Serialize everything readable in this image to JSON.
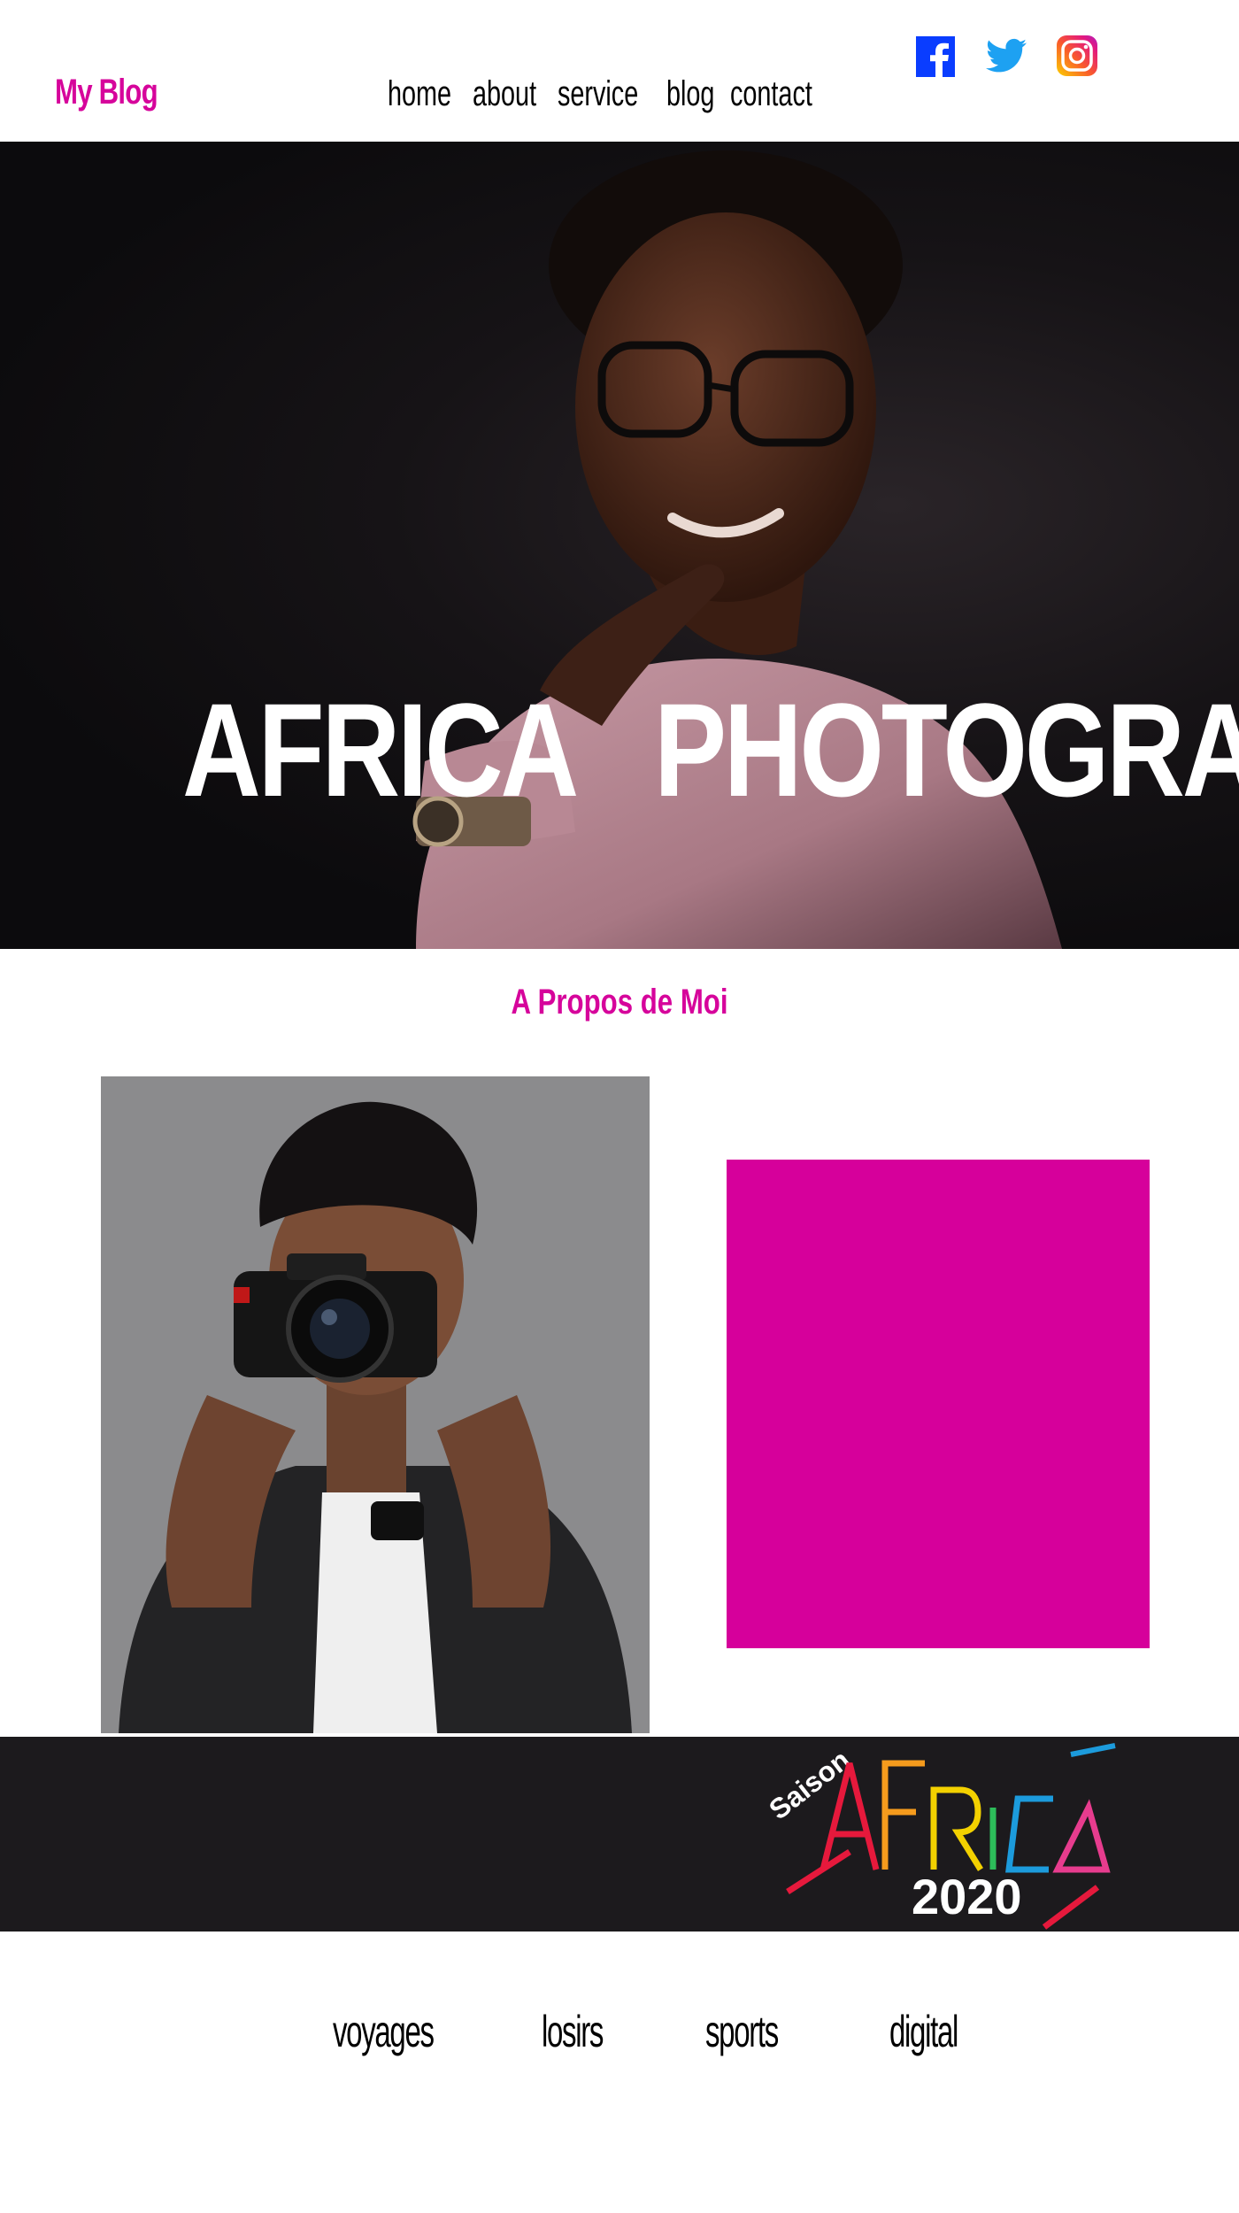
{
  "brand": {
    "title": "My Blog",
    "accent": "#d6049b"
  },
  "nav": {
    "items": [
      {
        "label": "home"
      },
      {
        "label": "about"
      },
      {
        "label": "service"
      },
      {
        "label": "blog"
      },
      {
        "label": "contact"
      }
    ]
  },
  "social": {
    "items": [
      {
        "icon": "facebook-icon",
        "color": "#1877f2"
      },
      {
        "icon": "twitter-icon",
        "color": "#1da1f2"
      },
      {
        "icon": "instagram-icon",
        "color": "#f58529"
      }
    ]
  },
  "hero": {
    "title": "AFRICA   PHOTOGRAPHIE",
    "image": "woman-portrait-image"
  },
  "about": {
    "title": "A Propos de Moi",
    "photo": "photographer-image",
    "box_color": "#d6009b"
  },
  "banner": {
    "logo": "saison-africa-2020-logo",
    "logo_text": {
      "saison": "Saison",
      "africa": "AFRICA",
      "year": "2020"
    }
  },
  "categories": {
    "items": [
      {
        "label": "voyages"
      },
      {
        "label": "losirs"
      },
      {
        "label": "sports"
      },
      {
        "label": "digital"
      }
    ]
  }
}
